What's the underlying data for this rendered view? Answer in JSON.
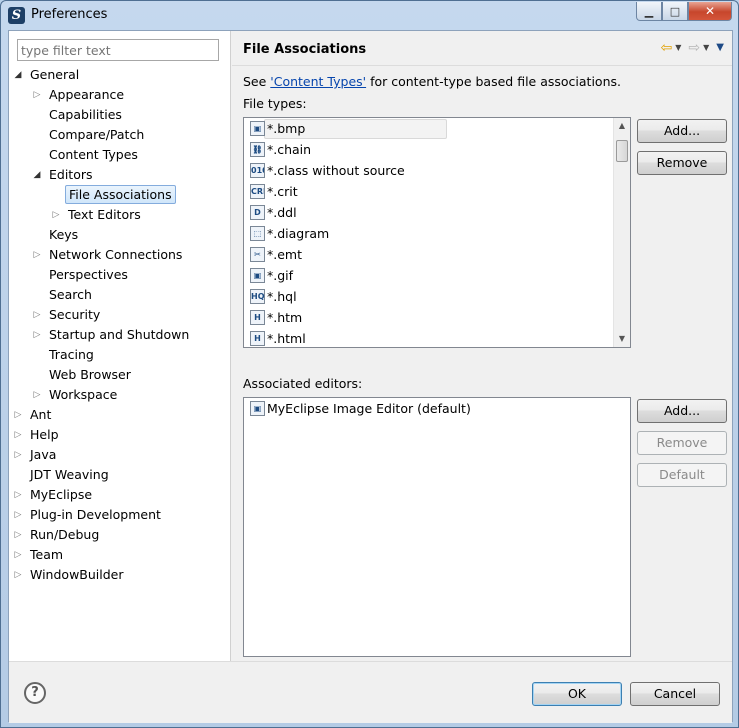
{
  "window": {
    "title": "Preferences"
  },
  "filter": {
    "placeholder": "type filter text"
  },
  "tree": [
    {
      "label": "General",
      "depth": 0,
      "toggle": "open"
    },
    {
      "label": "Appearance",
      "depth": 1,
      "toggle": "closed"
    },
    {
      "label": "Capabilities",
      "depth": 1,
      "toggle": "none"
    },
    {
      "label": "Compare/Patch",
      "depth": 1,
      "toggle": "none"
    },
    {
      "label": "Content Types",
      "depth": 1,
      "toggle": "none"
    },
    {
      "label": "Editors",
      "depth": 1,
      "toggle": "open"
    },
    {
      "label": "File Associations",
      "depth": 2,
      "toggle": "none",
      "selected": true
    },
    {
      "label": "Text Editors",
      "depth": 2,
      "toggle": "closed"
    },
    {
      "label": "Keys",
      "depth": 1,
      "toggle": "none"
    },
    {
      "label": "Network Connections",
      "depth": 1,
      "toggle": "closed"
    },
    {
      "label": "Perspectives",
      "depth": 1,
      "toggle": "none"
    },
    {
      "label": "Search",
      "depth": 1,
      "toggle": "none"
    },
    {
      "label": "Security",
      "depth": 1,
      "toggle": "closed"
    },
    {
      "label": "Startup and Shutdown",
      "depth": 1,
      "toggle": "closed"
    },
    {
      "label": "Tracing",
      "depth": 1,
      "toggle": "none"
    },
    {
      "label": "Web Browser",
      "depth": 1,
      "toggle": "none"
    },
    {
      "label": "Workspace",
      "depth": 1,
      "toggle": "closed"
    },
    {
      "label": "Ant",
      "depth": 0,
      "toggle": "closed"
    },
    {
      "label": "Help",
      "depth": 0,
      "toggle": "closed"
    },
    {
      "label": "Java",
      "depth": 0,
      "toggle": "closed"
    },
    {
      "label": "JDT Weaving",
      "depth": 0,
      "toggle": "none"
    },
    {
      "label": "MyEclipse",
      "depth": 0,
      "toggle": "closed"
    },
    {
      "label": "Plug-in Development",
      "depth": 0,
      "toggle": "closed"
    },
    {
      "label": "Run/Debug",
      "depth": 0,
      "toggle": "closed"
    },
    {
      "label": "Team",
      "depth": 0,
      "toggle": "closed"
    },
    {
      "label": "WindowBuilder",
      "depth": 0,
      "toggle": "closed"
    }
  ],
  "page": {
    "title": "File Associations",
    "see_prefix": "See ",
    "see_link": "'Content Types'",
    "see_suffix": " for content-type based file associations.",
    "file_types_label": "File types:",
    "associated_label": "Associated editors:"
  },
  "file_types": [
    {
      "label": "*.bmp",
      "icon": "image-file-icon",
      "glyph": "▣",
      "selected": true
    },
    {
      "label": "*.chain",
      "icon": "chain-file-icon",
      "glyph": "⛓"
    },
    {
      "label": "*.class without source",
      "icon": "class-file-icon",
      "glyph": "010"
    },
    {
      "label": "*.crit",
      "icon": "crit-file-icon",
      "glyph": "CRI"
    },
    {
      "label": "*.ddl",
      "icon": "ddl-file-icon",
      "glyph": "D"
    },
    {
      "label": "*.diagram",
      "icon": "diagram-file-icon",
      "glyph": "⬚"
    },
    {
      "label": "*.emt",
      "icon": "emt-file-icon",
      "glyph": "✂"
    },
    {
      "label": "*.gif",
      "icon": "gif-file-icon",
      "glyph": "▣"
    },
    {
      "label": "*.hql",
      "icon": "hql-file-icon",
      "glyph": "HQL"
    },
    {
      "label": "*.htm",
      "icon": "html-file-icon",
      "glyph": "H"
    },
    {
      "label": "*.html",
      "icon": "html-file-icon",
      "glyph": "H"
    }
  ],
  "file_buttons": {
    "add": "Add...",
    "remove": "Remove"
  },
  "editors": [
    {
      "label": "MyEclipse Image Editor (default)",
      "icon": "image-editor-icon",
      "glyph": "▣"
    }
  ],
  "editor_buttons": {
    "add": "Add...",
    "remove": "Remove",
    "default": "Default"
  },
  "dialog_buttons": {
    "ok": "OK",
    "cancel": "Cancel"
  },
  "help_glyph": "?",
  "nav_icons": {
    "back": "⇦",
    "forward": "⇨",
    "menu": "▼"
  }
}
